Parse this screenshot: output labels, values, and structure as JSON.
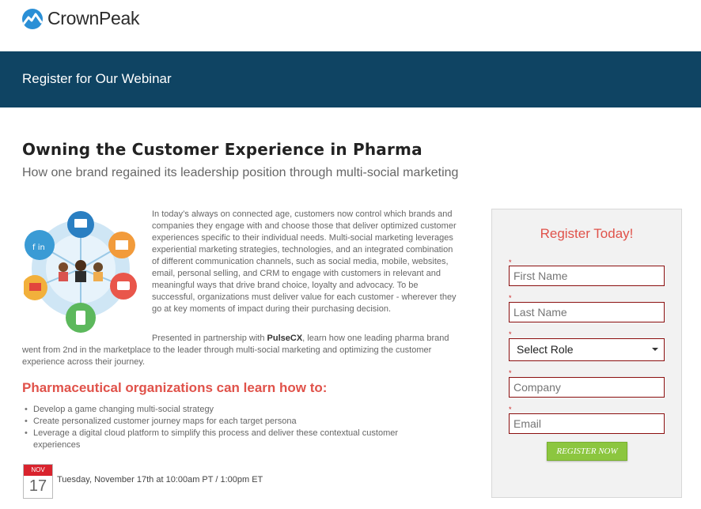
{
  "header": {
    "brand": "CrownPeak",
    "logo_icon": "crownpeak-logo-icon"
  },
  "banner": {
    "title": "Register for Our Webinar"
  },
  "main": {
    "title": "Owning the Customer Experience in Pharma",
    "subtitle": "How one brand regained its leadership position through multi-social marketing",
    "intro": "In today’s always on connected age, customers now control which brands and companies they engage with and choose those that deliver optimized customer experiences specific to their individual needs. Multi-social marketing leverages experiential marketing strategies, technologies, and an integrated combination of different communication channels, such as social media, mobile, websites, email, personal selling, and CRM to engage with customers in relevant and meaningful ways that drive brand choice, loyalty and advocacy. To be successful, organizations must deliver value for each customer - wherever they go at key moments of impact during their purchasing decision.",
    "partner_prefix": "Presented in partnership with ",
    "partner_name": "PulseCX",
    "partner_suffix": ", learn how one leading pharma brand went from 2nd in the marketplace to the leader through multi-social marketing and optimizing the customer experience across their journey.",
    "learn_heading": "Pharmaceutical organizations can learn how to:",
    "bullets": [
      "Develop a game changing multi-social strategy",
      "Create personalized customer journey maps for each target persona",
      "Leverage a digital cloud platform to simplify this process and deliver these contextual customer experiences"
    ],
    "event": {
      "month": "NOV",
      "day": "17",
      "datetime": "Tuesday, November 17th at 10:00am PT / 1:00pm ET"
    },
    "illustration_icon": "multi-channel-network-illustration"
  },
  "registration": {
    "title": "Register Today!",
    "required_marker": "*",
    "first_name_placeholder": "First Name",
    "last_name_placeholder": "Last Name",
    "role_selected": "Select Role",
    "company_placeholder": "Company",
    "email_placeholder": "Email",
    "submit_label": "REGISTER NOW"
  },
  "colors": {
    "banner": "#0f4463",
    "accent_red": "#e0524a",
    "button_green": "#8cc63f",
    "field_border": "#8b0f0f"
  }
}
